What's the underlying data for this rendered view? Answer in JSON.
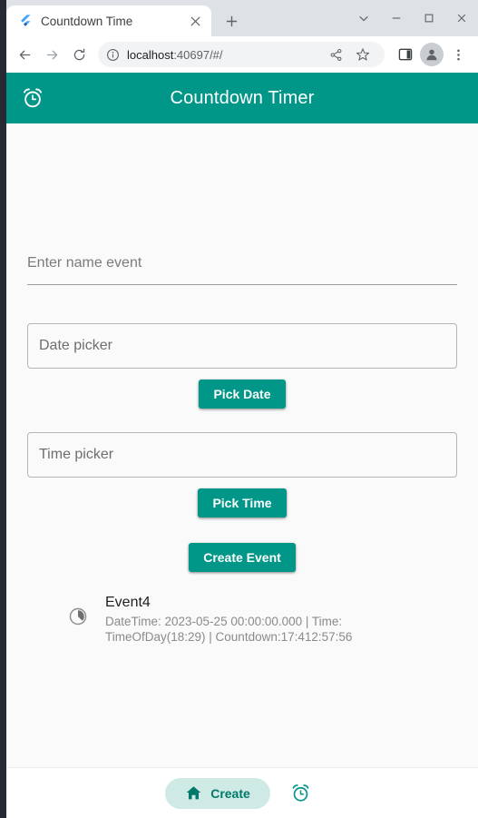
{
  "browser": {
    "tab": {
      "title": "Countdown Time",
      "favicon_icon": "flutter-logo-icon",
      "close_icon": "close-icon"
    },
    "new_tab_icon": "plus-icon",
    "window_controls": {
      "tab_search_icon": "chevron-down-icon",
      "minimize_icon": "minimize-icon",
      "maximize_icon": "maximize-icon",
      "close_icon": "close-icon"
    },
    "toolbar": {
      "back_icon": "back-arrow-icon",
      "forward_icon": "forward-arrow-icon",
      "reload_icon": "reload-icon",
      "site_info_icon": "info-circle-icon",
      "url_host": "localhost",
      "url_rest": ":40697/#/",
      "share_icon": "share-icon",
      "bookmark_icon": "star-icon",
      "side_panel_icon": "side-panel-icon",
      "profile_icon": "avatar-icon",
      "menu_icon": "three-dot-menu-icon"
    }
  },
  "app": {
    "appbar": {
      "leading_icon": "alarm-clock-icon",
      "title": "Countdown Timer",
      "background": "#009688"
    },
    "form": {
      "name_field": {
        "placeholder": "Enter name event",
        "value": ""
      },
      "date_field": {
        "placeholder": "Date picker",
        "value": ""
      },
      "pick_date_button": "Pick Date",
      "time_field": {
        "placeholder": "Time picker",
        "value": ""
      },
      "pick_time_button": "Pick Time",
      "create_event_button": "Create Event"
    },
    "events": [
      {
        "icon": "timelapse-icon",
        "title": "Event4",
        "subtitle": "DateTime: 2023-05-25 00:00:00.000 | Time: TimeOfDay(18:29) | Countdown:17:412:57:56"
      }
    ],
    "bottom_nav": {
      "items": [
        {
          "icon": "home-icon",
          "label": "Create",
          "selected": true
        },
        {
          "icon": "alarm-clock-icon",
          "label": "",
          "selected": false
        }
      ]
    }
  }
}
